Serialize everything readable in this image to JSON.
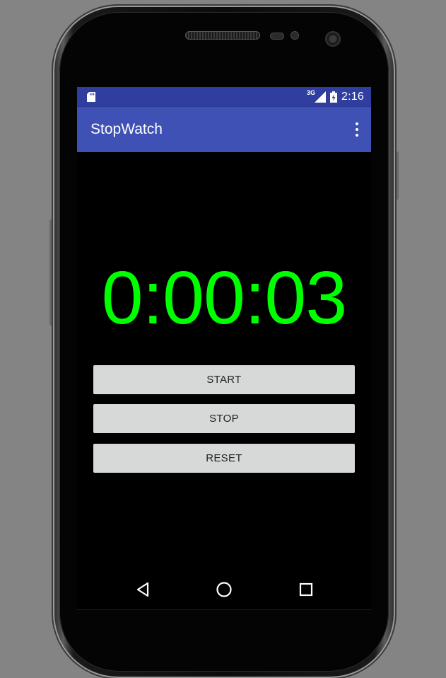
{
  "status_bar": {
    "network": "3G",
    "time": "2:16",
    "icons": [
      "sd-card-icon",
      "signal-icon",
      "battery-icon"
    ]
  },
  "app_bar": {
    "title": "StopWatch",
    "menu_icon": "overflow-menu-icon"
  },
  "timer": {
    "display": "0:00:03"
  },
  "buttons": {
    "start": "START",
    "stop": "STOP",
    "reset": "RESET"
  },
  "nav_bar": {
    "icons": [
      "back-icon",
      "home-icon",
      "recents-icon"
    ]
  },
  "colors": {
    "status_bar": "#303f9f",
    "app_bar": "#3f51b5",
    "timer_text": "#00ff00",
    "button_bg": "#d7d9d8",
    "screen_bg": "#000000"
  }
}
